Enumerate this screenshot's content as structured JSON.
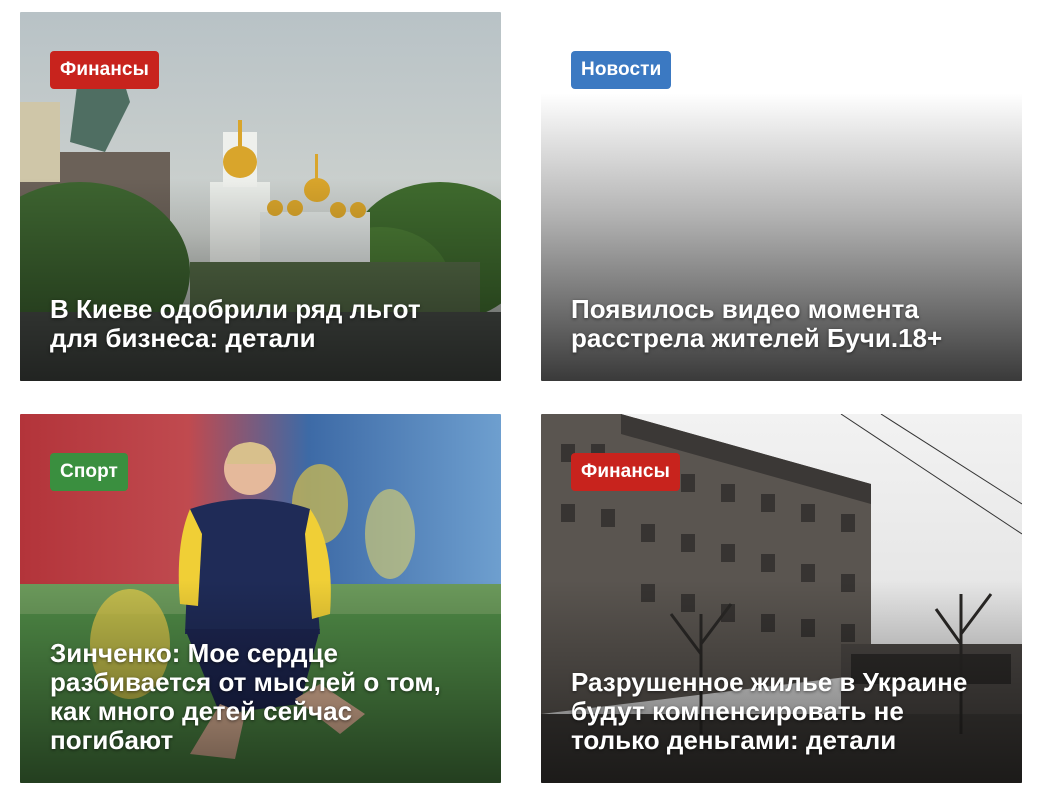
{
  "colors": {
    "finance": "#c8231d",
    "news": "#3b79c2",
    "sport": "#3a8f3f"
  },
  "cards": [
    {
      "category": "Финансы",
      "category_color": "#c8231d",
      "title": "В Киеве одобрили ряд льгот для бизнеса: детали",
      "image_icon": "kyiv-cathedral-photo"
    },
    {
      "category": "Новости",
      "category_color": "#3b79c2",
      "title": "Появилось видео момента расстрела жителей Бучи.18+",
      "image_icon": "blank-gradient-placeholder"
    },
    {
      "category": "Спорт",
      "category_color": "#3a8f3f",
      "title": "Зинченко: Мое сердце разбивается от мыслей о том, как много детей сейчас погибают",
      "image_icon": "footballer-photo"
    },
    {
      "category": "Финансы",
      "category_color": "#c8231d",
      "title": "Разрушенное жилье в Украине будут компенсировать не только деньгами: детали",
      "image_icon": "destroyed-building-photo"
    }
  ]
}
